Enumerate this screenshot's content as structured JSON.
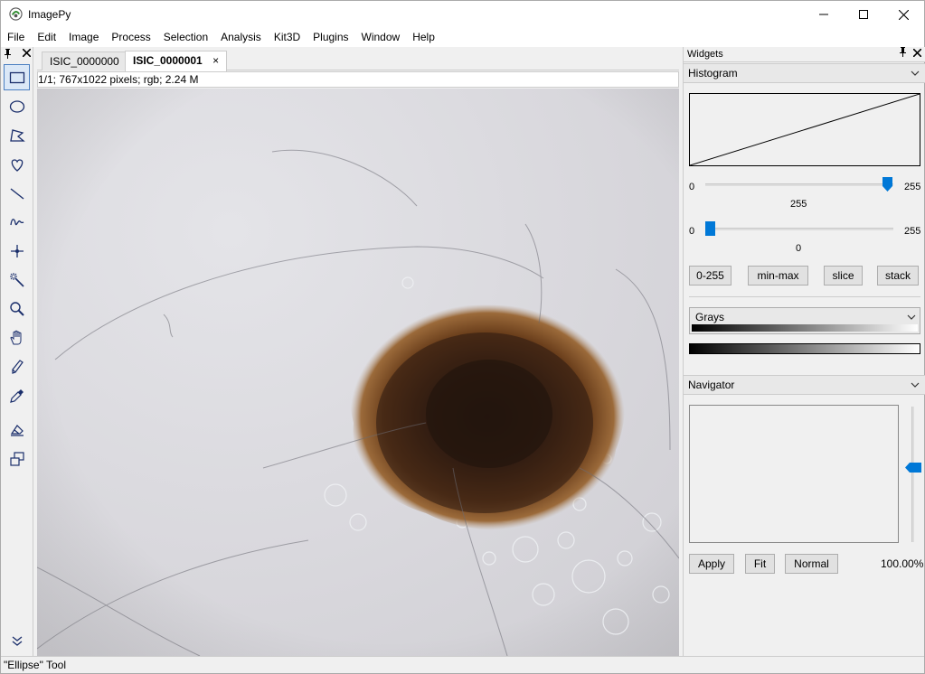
{
  "window": {
    "title": "ImagePy",
    "icons": {
      "app": "imagepy-logo-icon",
      "minimize": "minimize-icon",
      "maximize": "maximize-icon",
      "close": "close-icon"
    }
  },
  "menu": [
    "File",
    "Edit",
    "Image",
    "Process",
    "Selection",
    "Analysis",
    "Kit3D",
    "Plugins",
    "Window",
    "Help"
  ],
  "tools": [
    {
      "name": "rectangle-select-icon",
      "active": true
    },
    {
      "name": "ellipse-select-icon"
    },
    {
      "name": "polygon-select-icon"
    },
    {
      "name": "freehand-select-icon"
    },
    {
      "name": "line-icon"
    },
    {
      "name": "freeline-icon"
    },
    {
      "name": "point-icon"
    },
    {
      "name": "magic-wand-icon"
    },
    {
      "name": "zoom-icon"
    },
    {
      "name": "hand-pan-icon"
    },
    {
      "name": "pencil-icon"
    },
    {
      "name": "color-picker-icon"
    },
    {
      "name": "eraser-icon"
    },
    {
      "name": "copy-shapes-icon"
    }
  ],
  "tabs": [
    {
      "label": "ISIC_0000000",
      "active": false
    },
    {
      "label": "ISIC_0000001",
      "active": true,
      "close": "×"
    }
  ],
  "image_info": "1/1;  767x1022 pixels; rgb; 2.24 M",
  "widgets": {
    "title": "Widgets",
    "histogram": {
      "title": "Histogram",
      "slider_high": {
        "min": "0",
        "max": "255",
        "value": "255"
      },
      "slider_low": {
        "min": "0",
        "max": "255",
        "value": "0"
      },
      "buttons": [
        "0-255",
        "min-max",
        "slice",
        "stack"
      ]
    },
    "lut": {
      "selected": "Grays"
    },
    "navigator": {
      "title": "Navigator",
      "buttons": [
        "Apply",
        "Fit",
        "Normal"
      ],
      "zoom": "100.00%"
    }
  },
  "status": "\"Ellipse\" Tool",
  "colors": {
    "accent": "#0078d7",
    "lesion": "#4a2a14",
    "skin": "#d9d8dd"
  }
}
